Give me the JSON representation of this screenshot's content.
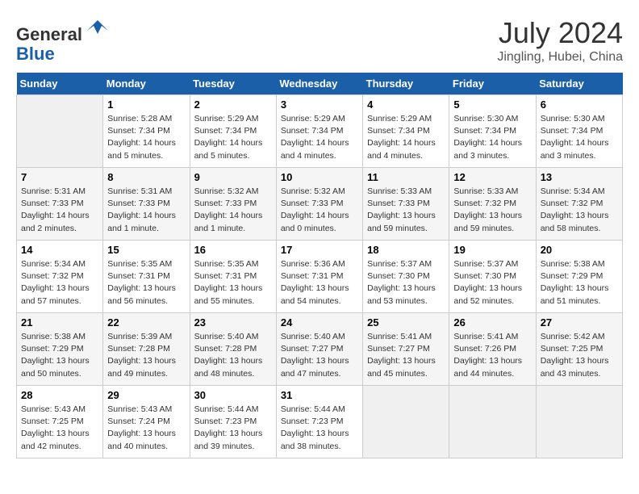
{
  "header": {
    "logo_line1": "General",
    "logo_line2": "Blue",
    "month_year": "July 2024",
    "location": "Jingling, Hubei, China"
  },
  "days_of_week": [
    "Sunday",
    "Monday",
    "Tuesday",
    "Wednesday",
    "Thursday",
    "Friday",
    "Saturday"
  ],
  "weeks": [
    [
      {
        "day": "",
        "empty": true
      },
      {
        "day": "1",
        "sunrise": "5:28 AM",
        "sunset": "7:34 PM",
        "daylight": "14 hours and 5 minutes."
      },
      {
        "day": "2",
        "sunrise": "5:29 AM",
        "sunset": "7:34 PM",
        "daylight": "14 hours and 5 minutes."
      },
      {
        "day": "3",
        "sunrise": "5:29 AM",
        "sunset": "7:34 PM",
        "daylight": "14 hours and 4 minutes."
      },
      {
        "day": "4",
        "sunrise": "5:29 AM",
        "sunset": "7:34 PM",
        "daylight": "14 hours and 4 minutes."
      },
      {
        "day": "5",
        "sunrise": "5:30 AM",
        "sunset": "7:34 PM",
        "daylight": "14 hours and 3 minutes."
      },
      {
        "day": "6",
        "sunrise": "5:30 AM",
        "sunset": "7:34 PM",
        "daylight": "14 hours and 3 minutes."
      }
    ],
    [
      {
        "day": "7",
        "sunrise": "5:31 AM",
        "sunset": "7:33 PM",
        "daylight": "14 hours and 2 minutes."
      },
      {
        "day": "8",
        "sunrise": "5:31 AM",
        "sunset": "7:33 PM",
        "daylight": "14 hours and 1 minute."
      },
      {
        "day": "9",
        "sunrise": "5:32 AM",
        "sunset": "7:33 PM",
        "daylight": "14 hours and 1 minute."
      },
      {
        "day": "10",
        "sunrise": "5:32 AM",
        "sunset": "7:33 PM",
        "daylight": "14 hours and 0 minutes."
      },
      {
        "day": "11",
        "sunrise": "5:33 AM",
        "sunset": "7:33 PM",
        "daylight": "13 hours and 59 minutes."
      },
      {
        "day": "12",
        "sunrise": "5:33 AM",
        "sunset": "7:32 PM",
        "daylight": "13 hours and 59 minutes."
      },
      {
        "day": "13",
        "sunrise": "5:34 AM",
        "sunset": "7:32 PM",
        "daylight": "13 hours and 58 minutes."
      }
    ],
    [
      {
        "day": "14",
        "sunrise": "5:34 AM",
        "sunset": "7:32 PM",
        "daylight": "13 hours and 57 minutes."
      },
      {
        "day": "15",
        "sunrise": "5:35 AM",
        "sunset": "7:31 PM",
        "daylight": "13 hours and 56 minutes."
      },
      {
        "day": "16",
        "sunrise": "5:35 AM",
        "sunset": "7:31 PM",
        "daylight": "13 hours and 55 minutes."
      },
      {
        "day": "17",
        "sunrise": "5:36 AM",
        "sunset": "7:31 PM",
        "daylight": "13 hours and 54 minutes."
      },
      {
        "day": "18",
        "sunrise": "5:37 AM",
        "sunset": "7:30 PM",
        "daylight": "13 hours and 53 minutes."
      },
      {
        "day": "19",
        "sunrise": "5:37 AM",
        "sunset": "7:30 PM",
        "daylight": "13 hours and 52 minutes."
      },
      {
        "day": "20",
        "sunrise": "5:38 AM",
        "sunset": "7:29 PM",
        "daylight": "13 hours and 51 minutes."
      }
    ],
    [
      {
        "day": "21",
        "sunrise": "5:38 AM",
        "sunset": "7:29 PM",
        "daylight": "13 hours and 50 minutes."
      },
      {
        "day": "22",
        "sunrise": "5:39 AM",
        "sunset": "7:28 PM",
        "daylight": "13 hours and 49 minutes."
      },
      {
        "day": "23",
        "sunrise": "5:40 AM",
        "sunset": "7:28 PM",
        "daylight": "13 hours and 48 minutes."
      },
      {
        "day": "24",
        "sunrise": "5:40 AM",
        "sunset": "7:27 PM",
        "daylight": "13 hours and 47 minutes."
      },
      {
        "day": "25",
        "sunrise": "5:41 AM",
        "sunset": "7:27 PM",
        "daylight": "13 hours and 45 minutes."
      },
      {
        "day": "26",
        "sunrise": "5:41 AM",
        "sunset": "7:26 PM",
        "daylight": "13 hours and 44 minutes."
      },
      {
        "day": "27",
        "sunrise": "5:42 AM",
        "sunset": "7:25 PM",
        "daylight": "13 hours and 43 minutes."
      }
    ],
    [
      {
        "day": "28",
        "sunrise": "5:43 AM",
        "sunset": "7:25 PM",
        "daylight": "13 hours and 42 minutes."
      },
      {
        "day": "29",
        "sunrise": "5:43 AM",
        "sunset": "7:24 PM",
        "daylight": "13 hours and 40 minutes."
      },
      {
        "day": "30",
        "sunrise": "5:44 AM",
        "sunset": "7:23 PM",
        "daylight": "13 hours and 39 minutes."
      },
      {
        "day": "31",
        "sunrise": "5:44 AM",
        "sunset": "7:23 PM",
        "daylight": "13 hours and 38 minutes."
      },
      {
        "day": "",
        "empty": true
      },
      {
        "day": "",
        "empty": true
      },
      {
        "day": "",
        "empty": true
      }
    ]
  ],
  "labels": {
    "sunrise": "Sunrise:",
    "sunset": "Sunset:",
    "daylight": "Daylight:"
  }
}
